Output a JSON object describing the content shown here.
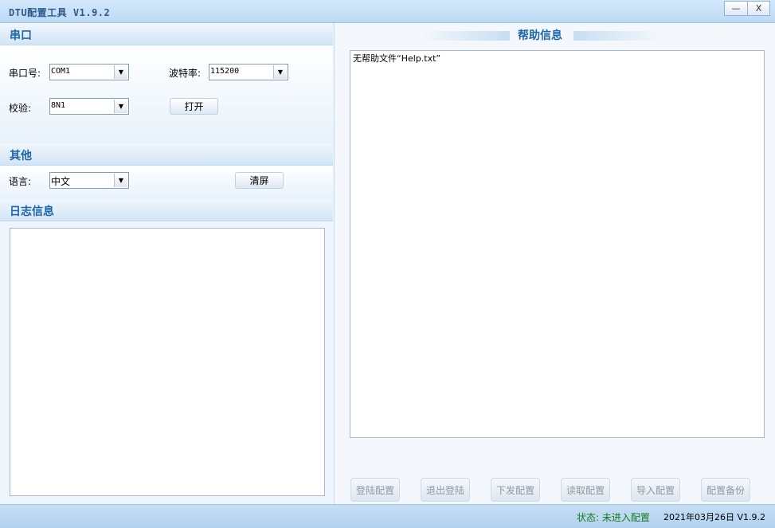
{
  "app": {
    "title": "DTU配置工具 V1.9.2"
  },
  "window_controls": {
    "minimize": "—",
    "close": "X"
  },
  "serial": {
    "header": "串口",
    "port_label": "串口号:",
    "port_value": "COM1",
    "baud_label": "波特率:",
    "baud_value": "115200",
    "parity_label": "校验:",
    "parity_value": "8N1",
    "open_button": "打开"
  },
  "other": {
    "header": "其他",
    "language_label": "语言:",
    "language_value": "中文",
    "clear_button": "清屏"
  },
  "log": {
    "header": "日志信息",
    "content": ""
  },
  "help": {
    "header": "帮助信息",
    "content": "无帮助文件“Help.txt”"
  },
  "actions": {
    "login": "登陆配置",
    "logout": "退出登陆",
    "download": "下发配置",
    "read": "读取配置",
    "import": "导入配置",
    "backup": "配置备份"
  },
  "status": {
    "state": "状态: 未进入配置",
    "version": "2021年03月26日 V1.9.2"
  },
  "colors": {
    "accent": "#1f66a8",
    "status_ok": "#1a7a1a",
    "disabled_text": "#8f99a3"
  }
}
